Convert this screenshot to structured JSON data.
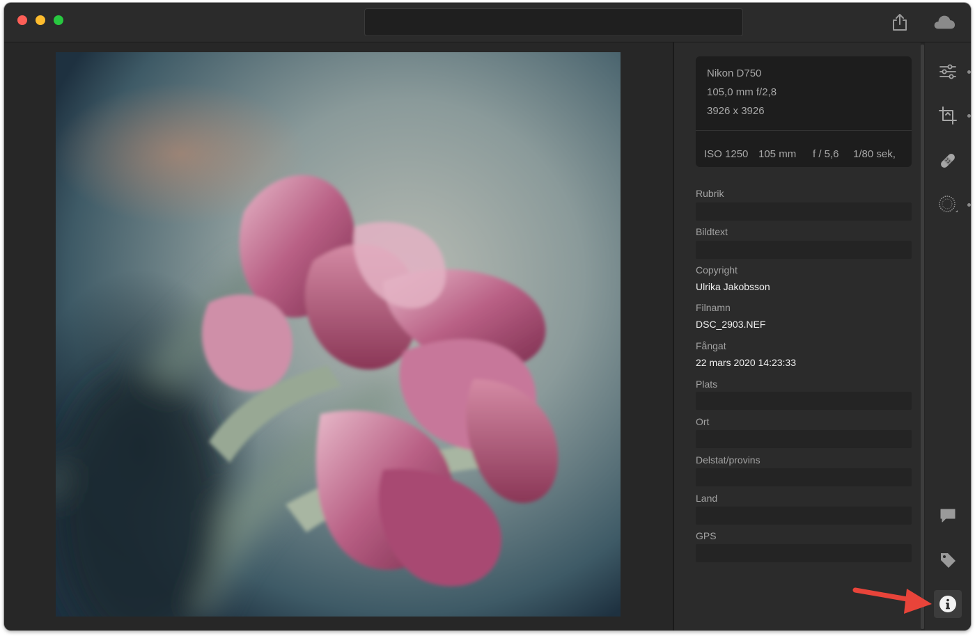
{
  "window": {
    "search": {
      "value": "",
      "placeholder": ""
    }
  },
  "photo": {
    "subject": "pink-tulip-photo"
  },
  "exif": {
    "camera": "Nikon D750",
    "lens": "105,0 mm f/2,8",
    "dimensions": "3926 x 3926",
    "iso": "ISO 1250",
    "focal_length": "105 mm",
    "aperture": "f / 5,6",
    "shutter": "1/80 sek,"
  },
  "fields": {
    "title_label": "Rubrik",
    "title_value": "",
    "caption_label": "Bildtext",
    "caption_value": "",
    "copyright_label": "Copyright",
    "copyright_value": "Ulrika Jakobsson",
    "filename_label": "Filnamn",
    "filename_value": "DSC_2903.NEF",
    "captured_label": "Fångat",
    "captured_value": "22 mars 2020 14:23:33",
    "location_label": "Plats",
    "location_value": "",
    "city_label": "Ort",
    "city_value": "",
    "state_label": "Delstat/provins",
    "state_value": "",
    "country_label": "Land",
    "country_value": "",
    "gps_label": "GPS",
    "gps_value": ""
  },
  "tools": {
    "edit": "sliders-icon",
    "crop": "crop-icon",
    "heal": "bandage-icon",
    "masking": "mask-circle-icon",
    "comments": "speech-bubble-icon",
    "keywords": "tag-icon",
    "info": "info-icon"
  },
  "colors": {
    "annotation_arrow": "#e8443a",
    "traffic_red": "#fe5f57",
    "traffic_yellow": "#febc2e",
    "traffic_green": "#28c840"
  }
}
